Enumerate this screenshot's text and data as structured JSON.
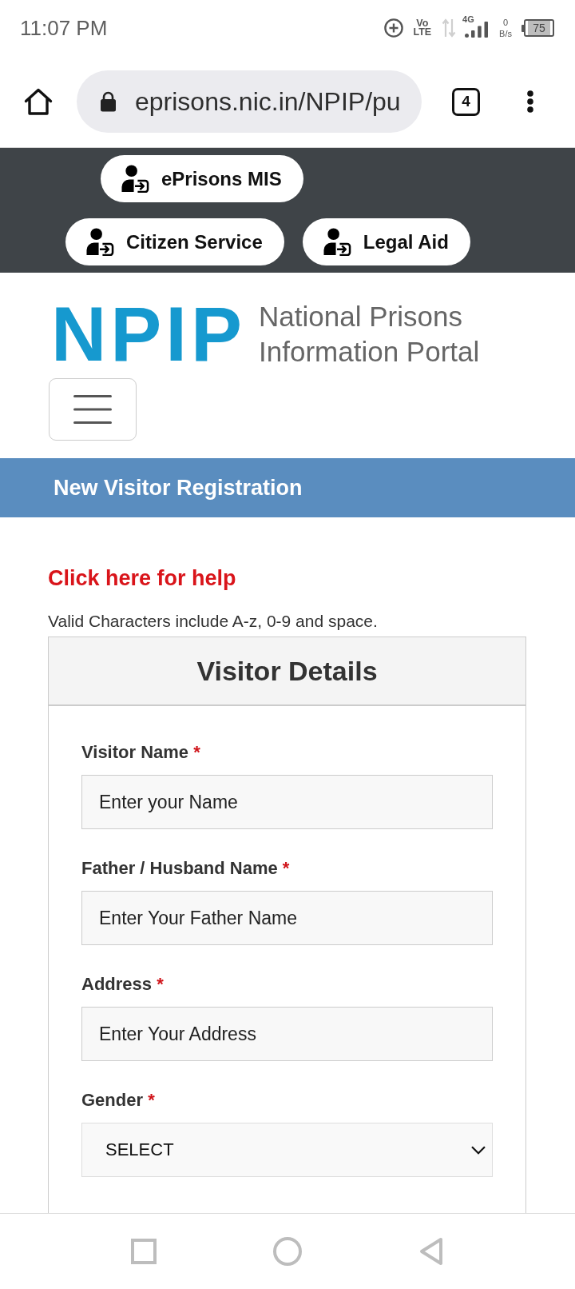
{
  "status_bar": {
    "time": "11:07 PM",
    "volte": "Vo LTE",
    "network": "4G",
    "speed": "0 B/s",
    "battery": "75"
  },
  "browser": {
    "url": "eprisons.nic.in/NPIP/pu",
    "tab_count": "4"
  },
  "top_nav": {
    "rows": [
      {
        "buttons": [
          {
            "label": "ePrisons MIS"
          }
        ]
      },
      {
        "buttons": [
          {
            "label": "Citizen Service"
          },
          {
            "label": "Legal Aid"
          }
        ]
      }
    ]
  },
  "header": {
    "logo": "NPIP",
    "title": "National Prisons Information Portal"
  },
  "banner": {
    "title": "New Visitor Registration"
  },
  "help_link": "Click here for help",
  "note": "Valid Characters include A-z, 0-9 and space.",
  "form": {
    "title": "Visitor Details",
    "fields": [
      {
        "kind": "text",
        "label": "Visitor Name",
        "required_mark": "*",
        "placeholder": "Enter your Name"
      },
      {
        "kind": "text",
        "label": "Father / Husband Name",
        "required_mark": "*",
        "placeholder": "Enter Your Father Name"
      },
      {
        "kind": "text",
        "label": "Address",
        "required_mark": "*",
        "placeholder": "Enter Your Address"
      },
      {
        "kind": "select",
        "label": "Gender",
        "required_mark": "*",
        "value": "SELECT"
      }
    ]
  }
}
